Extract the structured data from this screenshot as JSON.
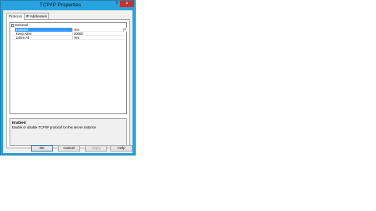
{
  "window": {
    "title": "TCP/IP Properties",
    "help_glyph": "?",
    "close_glyph": "×"
  },
  "tabs": [
    {
      "label": "Protocol",
      "active": true
    },
    {
      "label": "IP Addresses",
      "active": false
    }
  ],
  "grid": {
    "category": {
      "label": "General",
      "expander": "−"
    },
    "rows": [
      {
        "name": "Enabled",
        "value": "Yes",
        "selected": true
      },
      {
        "name": "Keep Alive",
        "value": "30000",
        "selected": false
      },
      {
        "name": "Listen All",
        "value": "Yes",
        "selected": false
      }
    ],
    "dropdown_glyph": "▾"
  },
  "description": {
    "title": "Enabled",
    "text": "Enable or disable TCP/IP protocol for this server instance"
  },
  "buttons": {
    "ok": "OK",
    "cancel": "Cancel",
    "apply": "Apply",
    "help": "Help"
  },
  "colors": {
    "window_frame": "#29a3e0",
    "close_button": "#c7312a",
    "selection": "#3399ff"
  }
}
